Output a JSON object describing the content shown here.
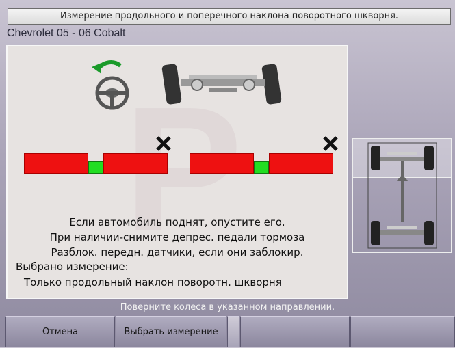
{
  "header": {
    "title": "Измерение продольного и поперечного наклона поворотного шкворня."
  },
  "vehicle": {
    "name": "Chevrolet 05 - 06 Cobalt"
  },
  "panel": {
    "messages": [
      "Если автомобиль поднят, опустите его.",
      "При наличии-снимите депрес. педали тормоза",
      "Разблок. передн. датчики, если они заблокир."
    ],
    "selected_label": "Выбрано измерение:",
    "selected_value": "Только продольный наклон поворотн. шкворня"
  },
  "status": {
    "text": "Поверните колеса в указанном направлении."
  },
  "buttons": [
    {
      "label": "Отмена"
    },
    {
      "label": "Выбрать измерение"
    },
    {
      "label": ""
    },
    {
      "label": ""
    }
  ],
  "colors": {
    "gauge_red": "#ee1111",
    "gauge_green": "#22dd22",
    "arrow_green": "#1a9a2a"
  },
  "icons": [
    "steering-wheel-icon",
    "turn-left-arrow-icon",
    "front-axle-icon",
    "x-mark-icon",
    "vehicle-overview-icon"
  ]
}
